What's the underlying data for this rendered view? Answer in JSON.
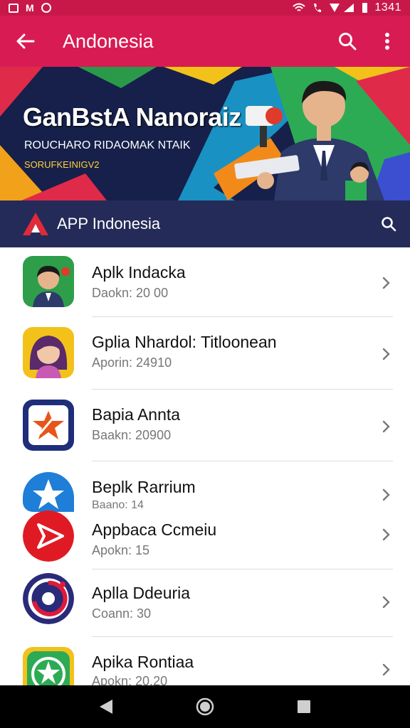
{
  "status_bar": {
    "time": "1341",
    "icons": [
      "sim-icon",
      "mail-icon",
      "face-icon",
      "wifi-icon",
      "phone-icon",
      "signal-icon",
      "battery-icon"
    ]
  },
  "app_bar": {
    "title": "Andonesia",
    "back_icon": "back-arrow-icon",
    "search_icon": "search-icon",
    "menu_icon": "more-vert-icon",
    "color": "#d81b52"
  },
  "banner": {
    "headline": "GanBstA Nanoraiz",
    "subline": "ROUCHARO RIDAOMAK NTAIK",
    "tag": "SORUFKEINIGV2"
  },
  "sub_header": {
    "logo_icon": "app-logo-icon",
    "label": "APP Indonesia",
    "search_icon": "search-icon",
    "color": "#252b58"
  },
  "apps": [
    {
      "name": "Aplk Indacka",
      "meta": "Daokn: 20 00",
      "icon": "man-avatar-icon"
    },
    {
      "name": "Gplia Nhardol: Titloonean",
      "meta": "Aporin: 24910",
      "icon": "woman-avatar-icon"
    },
    {
      "name": "Bapia Annta",
      "meta": "Baakn: 20900",
      "icon": "star-logo-icon"
    },
    {
      "name": "Beplk Rarrium",
      "meta": "Baano: 14",
      "icon": "blue-star-icon"
    },
    {
      "name": "Appbaca Ccmeiu",
      "meta": "Apokn: 15",
      "icon": "red-play-icon"
    },
    {
      "name": "Aplla Ddeuria",
      "meta": "Coann: 30",
      "icon": "swirl-logo-icon"
    },
    {
      "name": "Apika Rontiaa",
      "meta": "Apokn: 20.20",
      "icon": "green-star-icon"
    }
  ],
  "nav_bar": {
    "back": "nav-back-icon",
    "home": "nav-home-icon",
    "recents": "nav-recents-icon"
  }
}
